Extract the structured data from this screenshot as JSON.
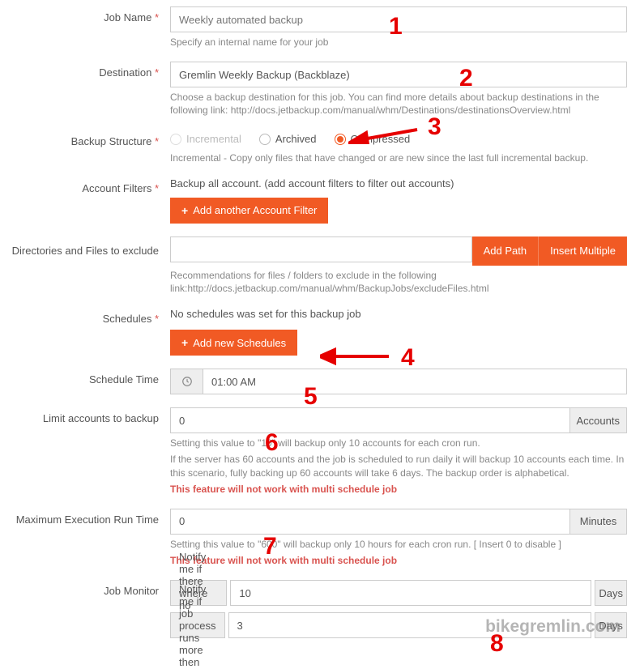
{
  "jobName": {
    "label": "Job Name",
    "placeholder": "Weekly automated backup",
    "help": "Specify an internal name for your job"
  },
  "destination": {
    "label": "Destination",
    "value": "Gremlin Weekly Backup (Backblaze)",
    "help": "Choose a backup destination for this job. You can find more details about backup destinations in the following link: http://docs.jetbackup.com/manual/whm/Destinations/destinationsOverview.html"
  },
  "structure": {
    "label": "Backup Structure",
    "options": [
      "Incremental",
      "Archived",
      "Compressed"
    ],
    "selected": "Compressed",
    "disabled": [
      "Incremental"
    ],
    "help": "Incremental - Copy only files that have changed or are new since the last full incremental backup."
  },
  "filters": {
    "label": "Account Filters",
    "text": "Backup all account. (add account filters to filter out accounts)",
    "addBtn": "Add another Account Filter"
  },
  "exclude": {
    "label": "Directories and Files to exclude",
    "addPath": "Add Path",
    "insertMulti": "Insert Multiple",
    "help": "Recommendations for files / folders to exclude in the following link:http://docs.jetbackup.com/manual/whm/BackupJobs/excludeFiles.html"
  },
  "schedules": {
    "label": "Schedules",
    "text": "No schedules was set for this backup job",
    "addBtn": "Add new Schedules"
  },
  "scheduleTime": {
    "label": "Schedule Time",
    "value": "01:00 AM"
  },
  "limit": {
    "label": "Limit accounts to backup",
    "value": "0",
    "unit": "Accounts",
    "help1": "Setting this value to \"10\" will backup only 10 accounts for each cron run.",
    "help2": "If the server has 60 accounts and the job is scheduled to run daily it will backup 10 accounts each time. In this scenario, fully backing up 60 accounts will take 6 days. The backup order is alphabetical.",
    "warn": "This feature will not work with multi schedule job"
  },
  "maxExec": {
    "label": "Maximum Execution Run Time",
    "value": "0",
    "unit": "Minutes",
    "help": "Setting this value to \"600\" will backup only 10 hours for each cron run. [ Insert 0 to disable ]",
    "warn": "This feature will not work with multi schedule job"
  },
  "monitor": {
    "label": "Job Monitor",
    "row1Label": "Notify me if there where no backups for",
    "row1Value": "10",
    "row2Label": "Notify me if job process runs more then",
    "row2Value": "3",
    "unit": "Days"
  },
  "annotations": {
    "a1": "1",
    "a2": "2",
    "a3": "3",
    "a4": "4",
    "a5": "5",
    "a6": "6",
    "a7": "7",
    "a8": "8"
  },
  "watermark": "bikegremlin.com"
}
